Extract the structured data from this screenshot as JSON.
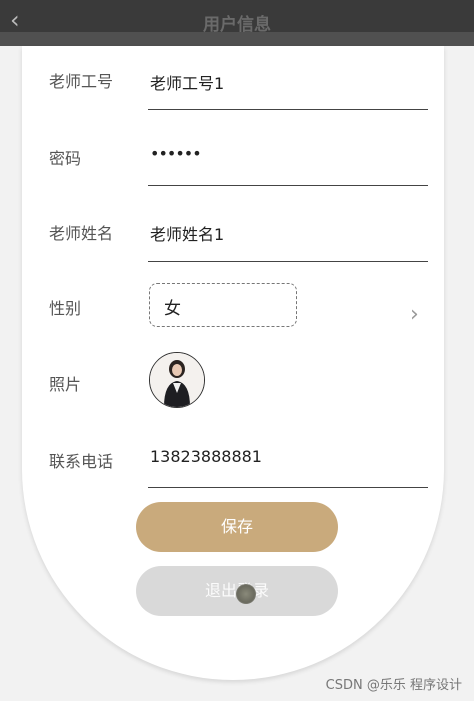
{
  "header": {
    "back_icon": "chevron-left-icon",
    "title": "用户信息"
  },
  "form": {
    "teacher_id": {
      "label": "老师工号",
      "value": "老师工号1"
    },
    "password": {
      "label": "密码",
      "value": "••••••"
    },
    "teacher_name": {
      "label": "老师姓名",
      "value": "老师姓名1"
    },
    "gender": {
      "label": "性别",
      "value": "女",
      "arrow_icon": "chevron-right-icon"
    },
    "photo": {
      "label": "照片"
    },
    "phone": {
      "label": "联系电话",
      "value": "13823888881"
    }
  },
  "buttons": {
    "save": "保存",
    "logout": "退出登录"
  },
  "colors": {
    "save": "#c9aa7c",
    "logout": "#d9d9d9",
    "topbar": "#3a3a3a"
  },
  "watermark": "CSDN @乐乐 程序设计"
}
